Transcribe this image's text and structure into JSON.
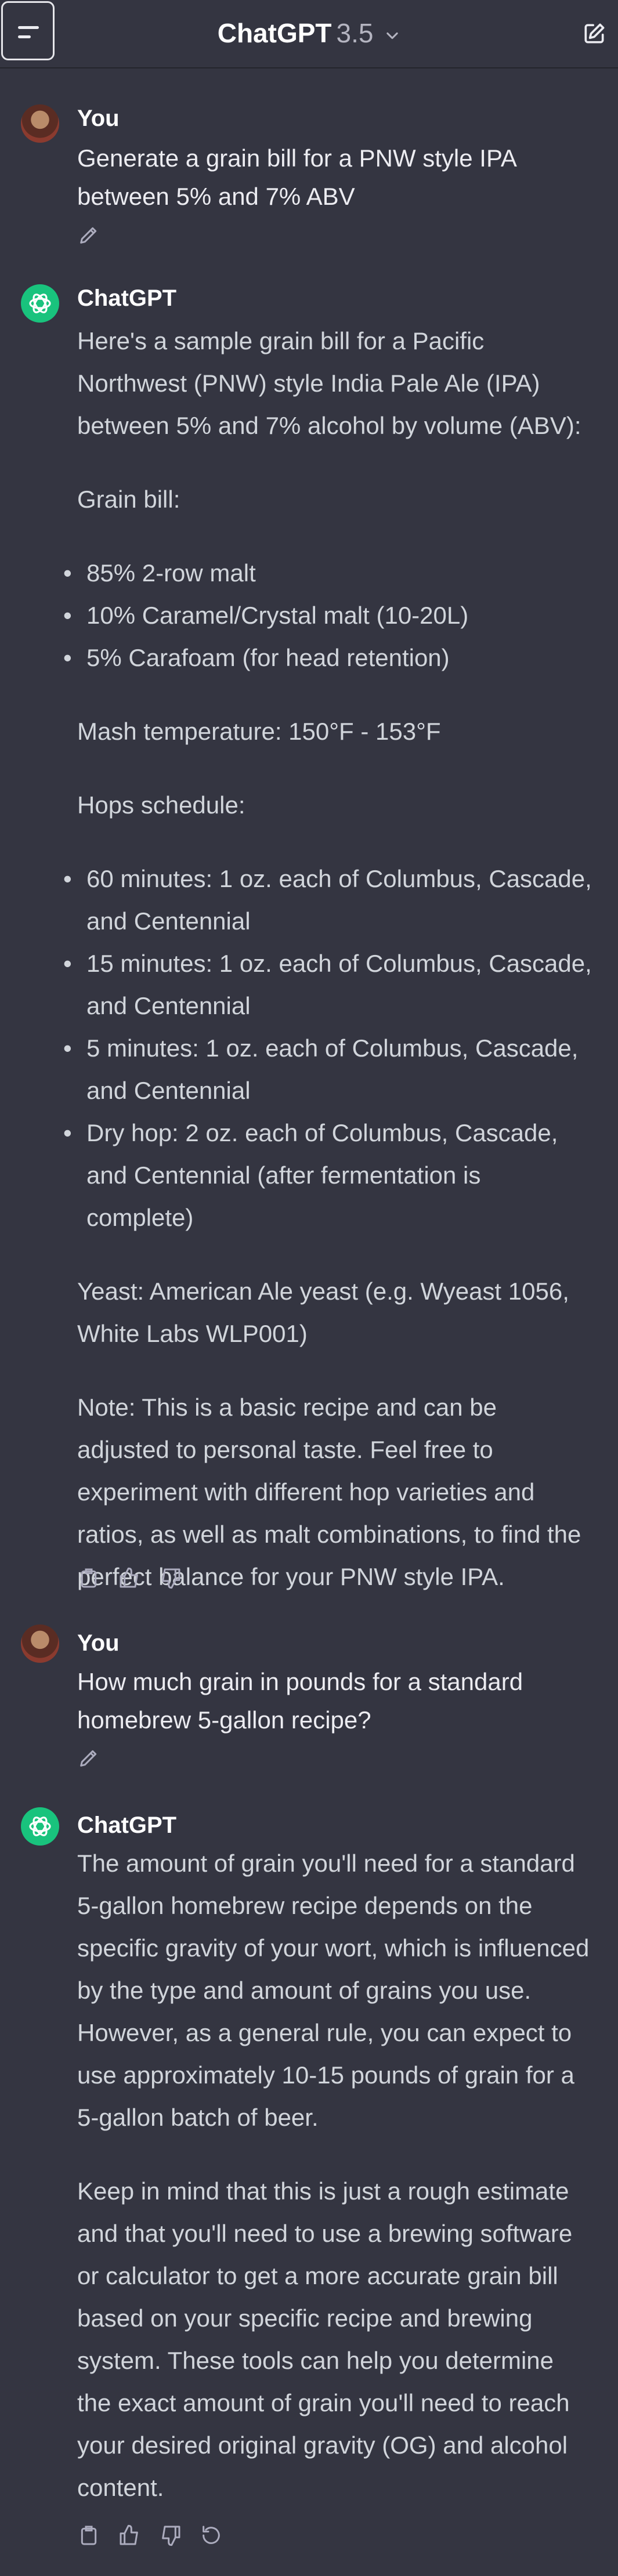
{
  "header": {
    "title": "ChatGPT",
    "version": "3.5"
  },
  "messages": [
    {
      "author": "You",
      "text": "Generate a grain bill for a PNW style IPA between 5% and 7% ABV"
    },
    {
      "author": "ChatGPT",
      "intro": "Here's a sample grain bill for a Pacific Northwest (PNW) style India Pale Ale (IPA) between 5% and 7% alcohol by volume (ABV):",
      "grain_heading": "Grain bill:",
      "grains": [
        "85% 2-row malt",
        "10% Caramel/Crystal malt (10-20L)",
        "5% Carafoam (for head retention)"
      ],
      "mash": "Mash temperature: 150°F - 153°F",
      "hops_heading": "Hops schedule:",
      "hops": [
        "60 minutes: 1 oz. each of Columbus, Cascade, and Centennial",
        "15 minutes: 1 oz. each of Columbus, Cascade, and Centennial",
        "5 minutes: 1 oz. each of Columbus, Cascade, and Centennial",
        "Dry hop: 2 oz. each of Columbus, Cascade, and Centennial (after fermentation is complete)"
      ],
      "yeast": "Yeast: American Ale yeast (e.g. Wyeast 1056, White Labs WLP001)",
      "note": "Note: This is a basic recipe and can be adjusted to personal taste. Feel free to experiment with different hop varieties and ratios, as well as malt combinations, to find the perfect balance for your PNW style IPA."
    },
    {
      "author": "You",
      "text": "How much grain in pounds for a standard homebrew 5-gallon recipe?"
    },
    {
      "author": "ChatGPT",
      "p1": "The amount of grain you'll need for a standard 5-gallon homebrew recipe depends on the specific gravity of your wort, which is influenced by the type and amount of grains you use. However, as a general rule, you can expect to use approximately 10-15 pounds of grain for a 5-gallon batch of beer.",
      "p2": "Keep in mind that this is just a rough estimate and that you'll need to use a brewing software or calculator to get a more accurate grain bill based on your specific recipe and brewing system. These tools can help you determine the exact amount of grain you'll need to reach your desired original gravity (OG) and alcohol content."
    }
  ],
  "colors": {
    "background": "#343541",
    "assistant_avatar": "#19c37d",
    "text": "#d1d5db"
  }
}
